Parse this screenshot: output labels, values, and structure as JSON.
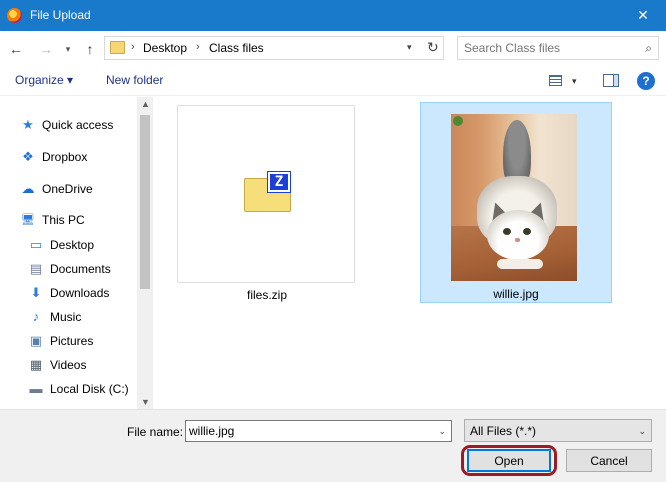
{
  "window": {
    "title": "File Upload",
    "close_glyph": "✕",
    "app_icon": "firefox-icon"
  },
  "nav": {
    "back_glyph": "←",
    "forward_glyph": "→",
    "recent_glyph": "⌄",
    "up_glyph": "↑",
    "breadcrumb": [
      {
        "label": "Desktop"
      },
      {
        "label": "Class files"
      }
    ],
    "breadcrumb_sep": "›",
    "address_drop_glyph": "⌄",
    "refresh_glyph": "↻"
  },
  "search": {
    "placeholder": "Search Class files",
    "icon_glyph": "⌕"
  },
  "toolbar": {
    "organize_label": "Organize ▾",
    "new_folder_label": "New folder",
    "view_drop_glyph": "▾",
    "help_glyph": "?"
  },
  "sidebar": {
    "items": [
      {
        "label": "Quick access",
        "icon": "star-icon",
        "glyph": "★",
        "color": "#2f7bd6"
      },
      {
        "label": "Dropbox",
        "icon": "dropbox-icon",
        "glyph": "❖",
        "color": "#1a6fd1"
      },
      {
        "label": "OneDrive",
        "icon": "cloud-icon",
        "glyph": "☁",
        "color": "#1a6fd1"
      },
      {
        "label": "This PC",
        "icon": "computer-icon",
        "glyph": "🖥",
        "color": "#2f7bd6"
      },
      {
        "label": "Desktop",
        "icon": "desktop-icon",
        "glyph": "▭",
        "color": "#1a86e0"
      },
      {
        "label": "Documents",
        "icon": "documents-icon",
        "glyph": "▤",
        "color": "#6a7d99"
      },
      {
        "label": "Downloads",
        "icon": "download-icon",
        "glyph": "⬇",
        "color": "#2a7de1"
      },
      {
        "label": "Music",
        "icon": "music-icon",
        "glyph": "♪",
        "color": "#2a7de1"
      },
      {
        "label": "Pictures",
        "icon": "pictures-icon",
        "glyph": "▣",
        "color": "#5a7fa6"
      },
      {
        "label": "Videos",
        "icon": "video-icon",
        "glyph": "▦",
        "color": "#4a5a6a"
      },
      {
        "label": "Local Disk (C:)",
        "icon": "disk-icon",
        "glyph": "▬",
        "color": "#6b7d8f"
      }
    ],
    "scroll_up_glyph": "▲",
    "scroll_down_glyph": "▼"
  },
  "files": [
    {
      "name": "files.zip",
      "type": "zip",
      "selected": false
    },
    {
      "name": "willie.jpg",
      "type": "image",
      "selected": true
    }
  ],
  "zip_badge": "Z",
  "bottom": {
    "filename_label": "File name:",
    "filename_value": "willie.jpg",
    "filter_value": "All Files (*.*)",
    "drop_glyph": "⌄",
    "open_label": "Open",
    "cancel_label": "Cancel"
  },
  "colors": {
    "titlebar": "#1979ca",
    "selection": "#cce8ff",
    "highlight_ring": "#9b1c24"
  }
}
